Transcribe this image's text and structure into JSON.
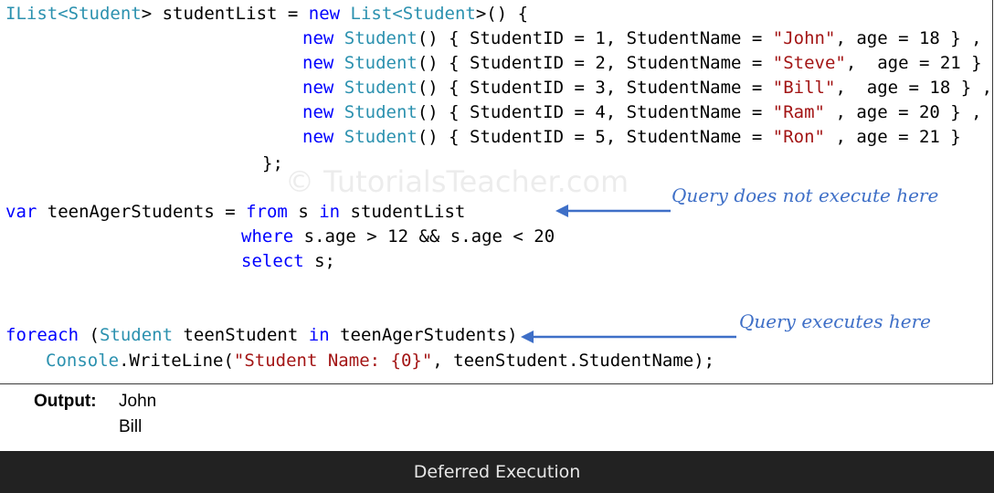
{
  "code": {
    "line1": {
      "t1": "IList",
      "t2": "<",
      "t3": "Student",
      "t4": "> studentList = ",
      "t5": "new",
      "t6": " ",
      "t7": "List",
      "t8": "<",
      "t9": "Student",
      "t10": ">() {"
    },
    "students": [
      {
        "kw": "new",
        "ty": "Student",
        "pre": "() { StudentID = 1, StudentName = ",
        "name": "\"John\"",
        "post": ", age = 18 } ,"
      },
      {
        "kw": "new",
        "ty": "Student",
        "pre": "() { StudentID = 2, StudentName = ",
        "name": "\"Steve\"",
        "post": ",  age = 21 } ,"
      },
      {
        "kw": "new",
        "ty": "Student",
        "pre": "() { StudentID = 3, StudentName = ",
        "name": "\"Bill\"",
        "post": ",  age = 18 } ,"
      },
      {
        "kw": "new",
        "ty": "Student",
        "pre": "() { StudentID = 4, StudentName = ",
        "name": "\"Ram\"",
        "post": " , age = 20 } ,"
      },
      {
        "kw": "new",
        "ty": "Student",
        "pre": "() { StudentID = 5, StudentName = ",
        "name": "\"Ron\"",
        "post": " , age = 21 }"
      }
    ],
    "close_list": "};",
    "query1": {
      "kw1": "var",
      "mid": " teenAgerStudents = ",
      "kw2": "from",
      "mid2": " s ",
      "kw3": "in",
      "end": " studentList"
    },
    "query2": {
      "kw": "where",
      "rest": " s.age > 12 && s.age < 20"
    },
    "query3": {
      "kw": "select",
      "rest": " s;"
    },
    "loop1": {
      "kw": "foreach",
      "p1": " (",
      "ty": "Student",
      "p2": " teenStudent ",
      "kw2": "in",
      "p3": " teenAgerStudents)"
    },
    "loop2": {
      "ty": "Console",
      "p1": ".WriteLine(",
      "str": "\"Student Name: {0}\"",
      "p2": ", teenStudent.StudentName);"
    }
  },
  "watermark": "© TutorialsTeacher.com",
  "annotations": {
    "query_not_execute": "Query does not execute here",
    "query_executes": "Query executes here"
  },
  "output": {
    "label": "Output:",
    "lines": [
      "John",
      "Bill"
    ]
  },
  "caption": "Deferred Execution",
  "colors": {
    "keyword": "#0000ff",
    "type": "#2b91af",
    "string": "#a31515",
    "annotation": "#3e6fc7",
    "caption_bg": "#222222"
  }
}
